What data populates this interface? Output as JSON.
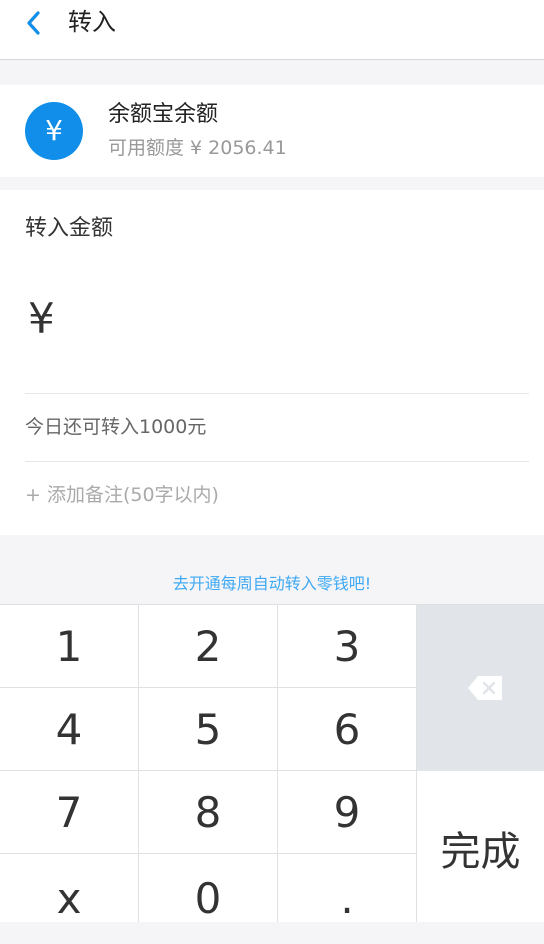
{
  "header": {
    "title": "转入",
    "back_icon": "chevron-left-icon"
  },
  "account": {
    "icon_glyph": "¥",
    "name": "余额宝余额",
    "available": "可用额度 ¥ 2056.41"
  },
  "amount": {
    "label": "转入金额",
    "currency_symbol": "¥",
    "input_value": "",
    "input_placeholder": ""
  },
  "limit": {
    "text": "今日还可转入1000元"
  },
  "note": {
    "text": "+ 添加备注(50字以内)"
  },
  "promo": {
    "text": "去开通每周自动转入零钱吧!"
  },
  "keypad": {
    "keys": [
      "1",
      "2",
      "3",
      "4",
      "5",
      "6",
      "7",
      "8",
      "9",
      "x",
      "0",
      "."
    ],
    "delete_icon": "backspace-icon",
    "done_label": "完成"
  },
  "colors": {
    "accent": "#108ee9",
    "link": "#3fa9f5",
    "delete_key_bg": "#e1e5ea"
  }
}
